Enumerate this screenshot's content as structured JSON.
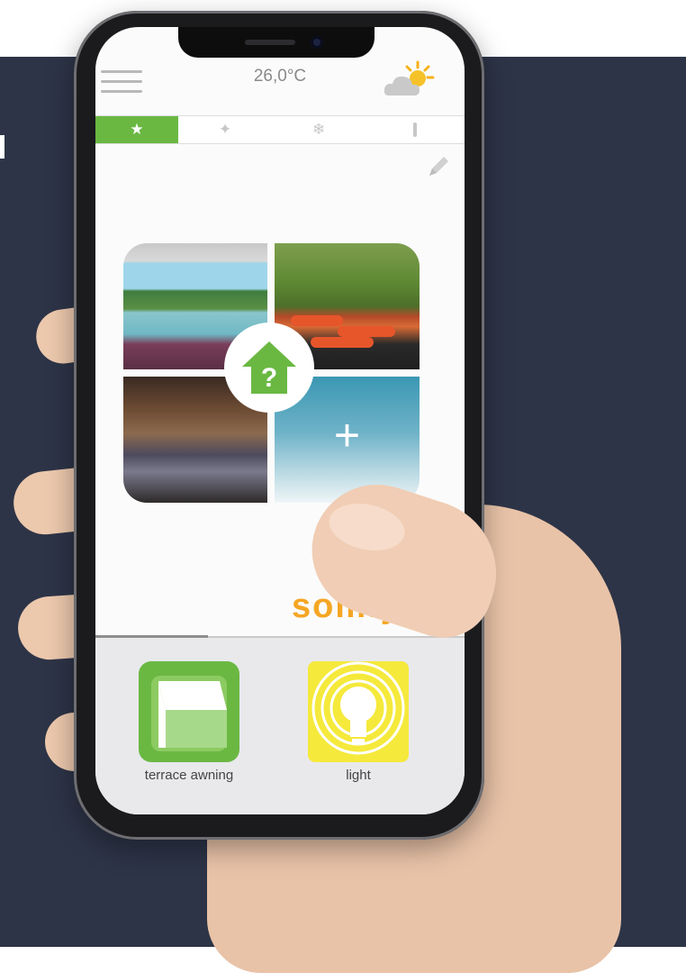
{
  "status_bar": {
    "temperature": "26,0°C",
    "weather_icon": "partly-sunny-icon"
  },
  "tabs": [
    {
      "icon": "star-icon",
      "glyph": "★",
      "active": true
    },
    {
      "icon": "sun-icon",
      "glyph": "✦",
      "active": false
    },
    {
      "icon": "snowflake-icon",
      "glyph": "❄",
      "active": false
    },
    {
      "icon": "thermometer-icon",
      "glyph": "🌡",
      "active": false
    }
  ],
  "scene_grid": {
    "add_label": "+",
    "home_icon_label": "?"
  },
  "brand": "somfy",
  "devices": [
    {
      "label": "terrace awning",
      "icon": "awning-icon",
      "color": "#6ab842"
    },
    {
      "label": "light",
      "icon": "light-bulb-icon",
      "color": "#f5e93b"
    }
  ],
  "colors": {
    "accent": "#6ab842",
    "brand": "#f5a623",
    "background": "#2d3447"
  }
}
